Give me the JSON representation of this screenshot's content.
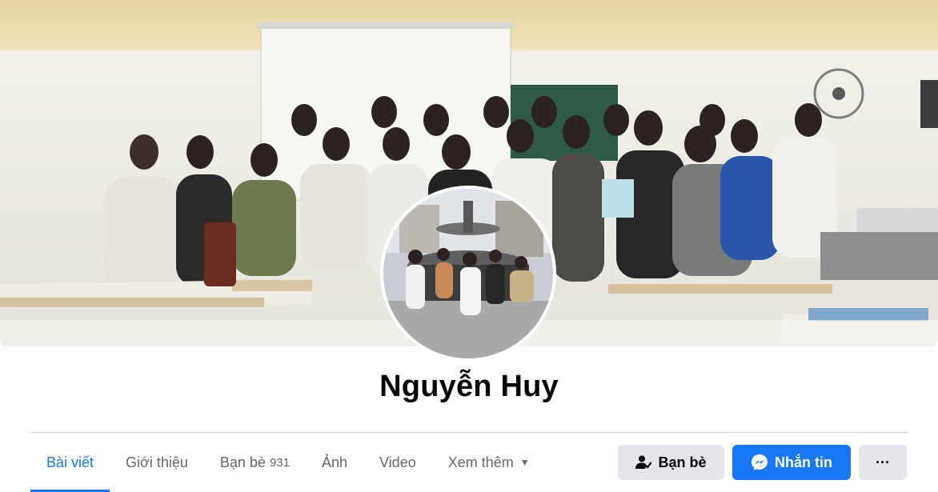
{
  "profile": {
    "name": "Nguyễn Huy"
  },
  "tabs": [
    {
      "label": "Bài viết",
      "active": true
    },
    {
      "label": "Giới thiệu"
    },
    {
      "label": "Bạn bè",
      "count": "931"
    },
    {
      "label": "Ảnh"
    },
    {
      "label": "Video"
    },
    {
      "label": "Xem thêm",
      "icon": "caret-down-icon"
    }
  ],
  "actions": {
    "friends_label": "Bạn bè",
    "friends_icon": "person-check-icon",
    "message_label": "Nhắn tin",
    "message_icon": "messenger-icon",
    "more_label": "···"
  },
  "colors": {
    "accent": "#1877f2",
    "button_gray": "#e4e6eb",
    "text_primary": "#050505",
    "text_secondary": "#65676b",
    "divider": "#ced0d4"
  }
}
